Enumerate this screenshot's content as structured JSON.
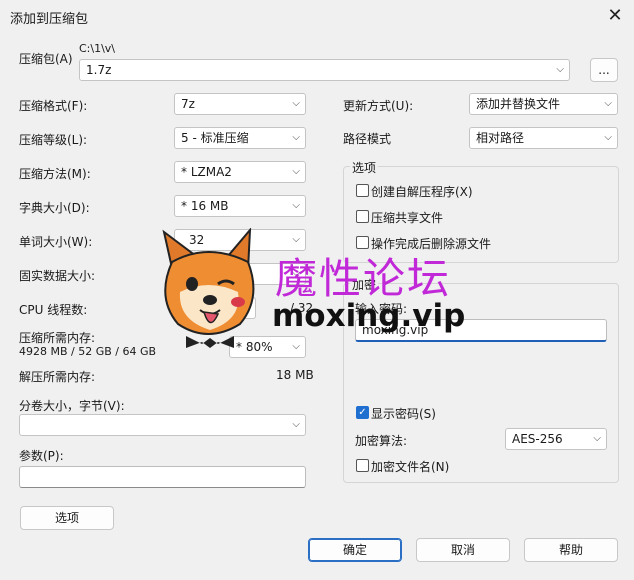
{
  "window": {
    "title": "添加到压缩包"
  },
  "archive": {
    "label": "压缩包(A)",
    "path": "C:\\1\\v\\",
    "name": "1.7z",
    "browse": "..."
  },
  "left": {
    "format": {
      "label": "压缩格式(F):",
      "value": "7z"
    },
    "level": {
      "label": "压缩等级(L):",
      "value": "5 - 标准压缩"
    },
    "method": {
      "label": "压缩方法(M):",
      "value": "*  LZMA2"
    },
    "dict": {
      "label": "字典大小(D):",
      "value": "*  16 MB"
    },
    "word": {
      "label": "单词大小(W):",
      "value": "32"
    },
    "solid": {
      "label": "固实数据大小:"
    },
    "cpu": {
      "label": "CPU 线程数:",
      "max": "/ 32"
    },
    "mem": {
      "label": "压缩所需内存:",
      "detail": "4928 MB / 52 GB / 64 GB",
      "value": "*  80%"
    },
    "demem": {
      "label": "解压所需内存:",
      "value": "18 MB"
    },
    "split": {
      "label": "分卷大小，字节(V):",
      "value": ""
    },
    "params": {
      "label": "参数(P):",
      "value": ""
    },
    "options_button": "选项"
  },
  "right": {
    "update": {
      "label": "更新方式(U):",
      "value": "添加并替换文件"
    },
    "path": {
      "label": "路径模式",
      "value": "相对路径"
    },
    "options": {
      "title": "选项",
      "sfx": "创建自解压程序(X)",
      "shared": "压缩共享文件",
      "delete": "操作完成后删除源文件"
    },
    "encryption": {
      "title": "加密",
      "pw_label": "输入密码:",
      "pw_value": "moxing.vip",
      "show": "显示密码(S)",
      "method_label": "加密算法:",
      "method_value": "AES-256",
      "encnames": "加密文件名(N)"
    }
  },
  "footer": {
    "ok": "确定",
    "cancel": "取消",
    "help": "帮助"
  },
  "watermark": {
    "cn": "魔性论坛",
    "en": "moxing.vip"
  }
}
